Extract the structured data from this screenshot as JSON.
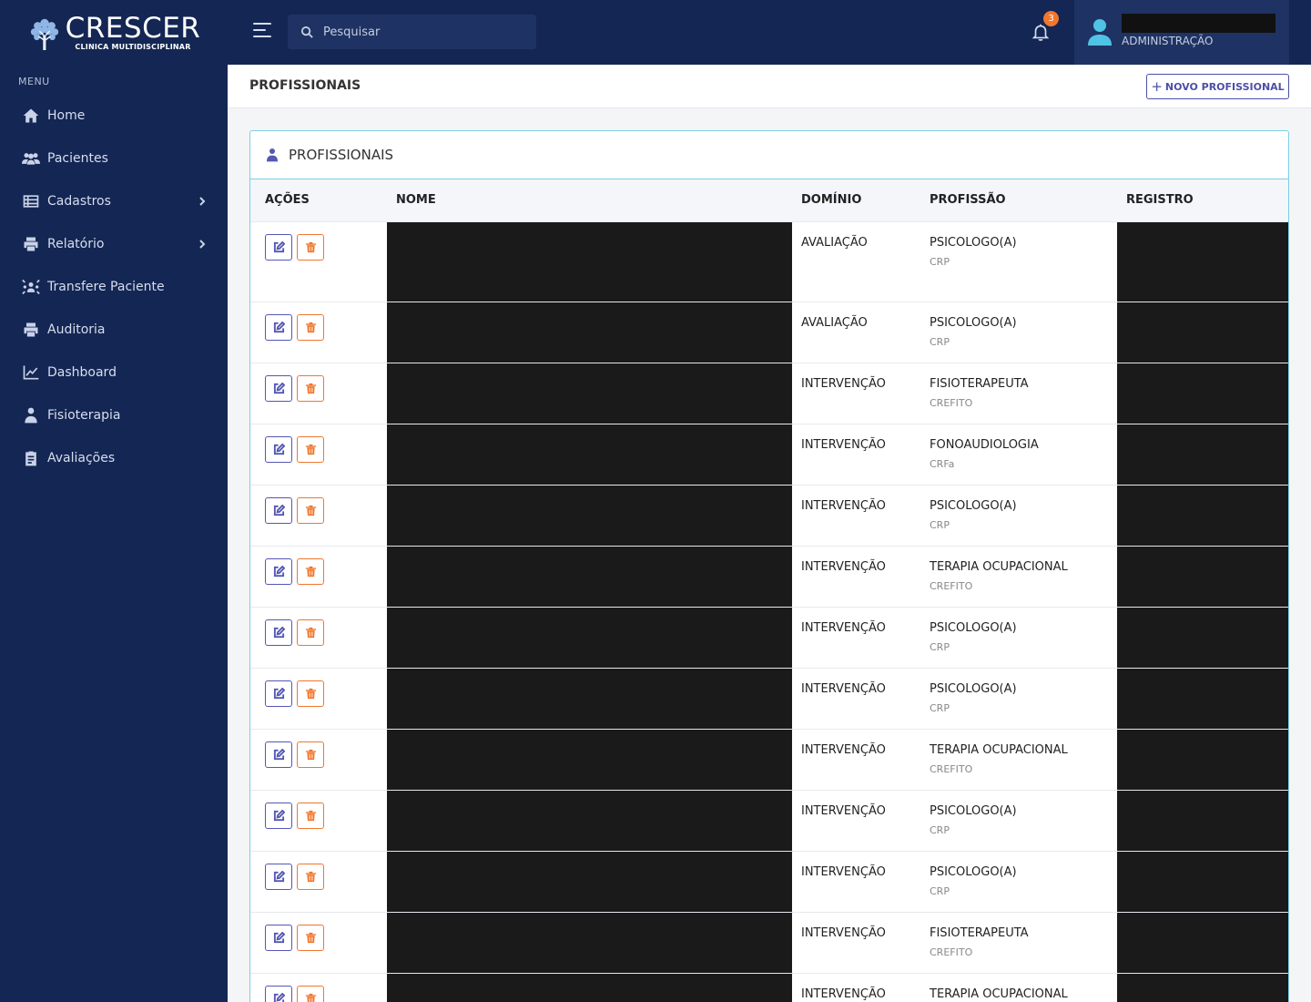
{
  "brand": {
    "name": "CRESCER",
    "tagline": "CLINICA MULTIDISCIPLINAR"
  },
  "sidebar": {
    "menu_label": "MENU",
    "items": [
      {
        "label": "Home",
        "icon": "home-icon",
        "has_submenu": false
      },
      {
        "label": "Pacientes",
        "icon": "users-icon",
        "has_submenu": false
      },
      {
        "label": "Cadastros",
        "icon": "table-icon",
        "has_submenu": true
      },
      {
        "label": "Relatório",
        "icon": "printer-icon",
        "has_submenu": true
      },
      {
        "label": "Transfere Paciente",
        "icon": "transfer-users-icon",
        "has_submenu": false
      },
      {
        "label": "Auditoria",
        "icon": "printer-icon",
        "has_submenu": false
      },
      {
        "label": "Dashboard",
        "icon": "chart-line-icon",
        "has_submenu": false
      },
      {
        "label": "Fisioterapia",
        "icon": "doctor-icon",
        "has_submenu": false
      },
      {
        "label": "Avaliações",
        "icon": "clipboard-icon",
        "has_submenu": false
      }
    ]
  },
  "topbar": {
    "search_placeholder": "Pesquisar",
    "notifications_count": "3",
    "user_role": "ADMINISTRAÇÃO"
  },
  "page": {
    "title": "PROFISSIONAIS",
    "new_button_label": "NOVO PROFISSIONAL"
  },
  "card": {
    "title": "PROFISSIONAIS"
  },
  "table": {
    "columns": [
      "AÇÕES",
      "NOME",
      "DOMÍNIO",
      "PROFISSÃO",
      "REGISTRO"
    ],
    "rows": [
      {
        "dominio": "AVALIAÇÃO",
        "profissao": "PSICOLOGO(A)",
        "conselho": "CRP"
      },
      {
        "dominio": "AVALIAÇÃO",
        "profissao": "PSICOLOGO(A)",
        "conselho": "CRP"
      },
      {
        "dominio": "INTERVENÇÃO",
        "profissao": "FISIOTERAPEUTA",
        "conselho": "CREFITO"
      },
      {
        "dominio": "INTERVENÇÃO",
        "profissao": "FONOAUDIOLOGIA",
        "conselho": "CRFa"
      },
      {
        "dominio": "INTERVENÇÃO",
        "profissao": "PSICOLOGO(A)",
        "conselho": "CRP"
      },
      {
        "dominio": "INTERVENÇÃO",
        "profissao": "TERAPIA OCUPACIONAL",
        "conselho": "CREFITO"
      },
      {
        "dominio": "INTERVENÇÃO",
        "profissao": "PSICOLOGO(A)",
        "conselho": "CRP"
      },
      {
        "dominio": "INTERVENÇÃO",
        "profissao": "PSICOLOGO(A)",
        "conselho": "CRP"
      },
      {
        "dominio": "INTERVENÇÃO",
        "profissao": "TERAPIA OCUPACIONAL",
        "conselho": "CREFITO"
      },
      {
        "dominio": "INTERVENÇÃO",
        "profissao": "PSICOLOGO(A)",
        "conselho": "CRP"
      },
      {
        "dominio": "INTERVENÇÃO",
        "profissao": "PSICOLOGO(A)",
        "conselho": "CRP"
      },
      {
        "dominio": "INTERVENÇÃO",
        "profissao": "FISIOTERAPEUTA",
        "conselho": "CREFITO"
      },
      {
        "dominio": "INTERVENÇÃO",
        "profissao": "TERAPIA OCUPACIONAL",
        "conselho": ""
      }
    ]
  },
  "colors": {
    "sidebar_bg": "#142653",
    "accent_purple": "#5457b3",
    "accent_orange": "#f0772d",
    "accent_cyan": "#4fc3e6"
  }
}
